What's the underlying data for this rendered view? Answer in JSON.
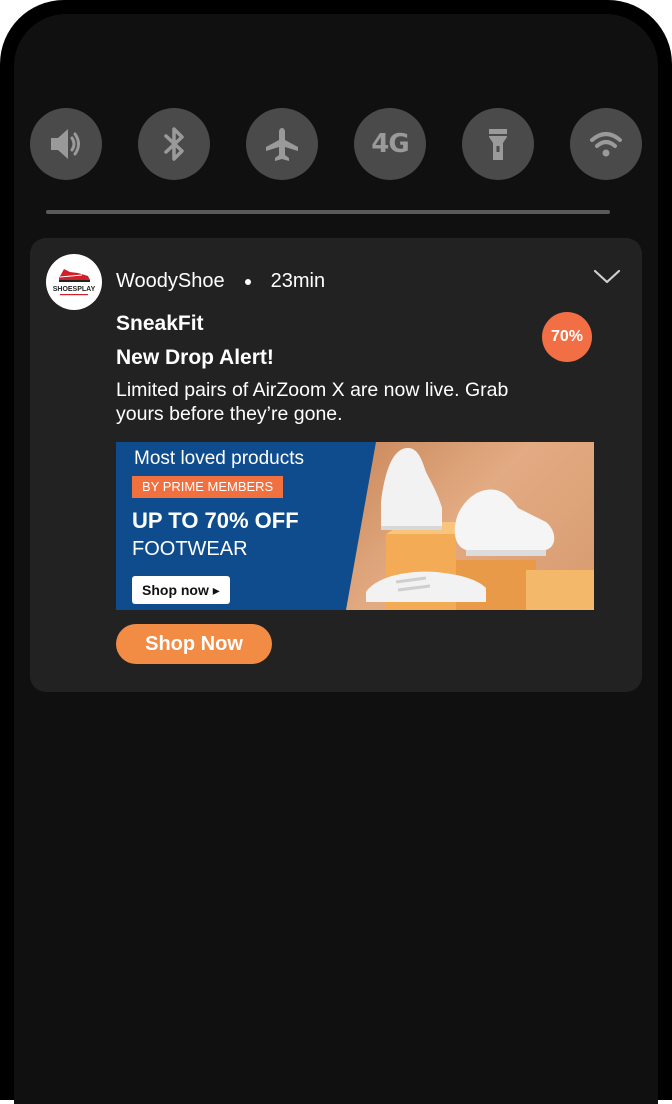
{
  "quick_settings": [
    {
      "name": "sound",
      "icon": "speaker-icon"
    },
    {
      "name": "bluetooth",
      "icon": "bluetooth-icon"
    },
    {
      "name": "airplane",
      "icon": "airplane-icon"
    },
    {
      "name": "mobile-data",
      "icon": "4g-icon",
      "label": "4G"
    },
    {
      "name": "flashlight",
      "icon": "flashlight-icon"
    },
    {
      "name": "wifi",
      "icon": "wifi-icon"
    }
  ],
  "notification": {
    "app_name": "WoodyShoe",
    "time": "23min",
    "logo_text": "SHOESPLAY",
    "title": "SneakFit",
    "headline": "New Drop Alert!",
    "body": "Limited pairs of AirZoom X are now live. Grab yours before they’re gone.",
    "badge": "70%",
    "banner": {
      "line1": "Most loved products",
      "tag": "BY PRIME MEMBERS",
      "line2": "UP TO 70% OFF",
      "line3": "FOOTWEAR",
      "shop": "Shop now ▸"
    },
    "action_label": "Shop Now"
  },
  "colors": {
    "accent": "#f28b43",
    "badge": "#f26f45",
    "card": "#222222",
    "screen": "#101010",
    "banner_blue": "#0f4c8d"
  }
}
